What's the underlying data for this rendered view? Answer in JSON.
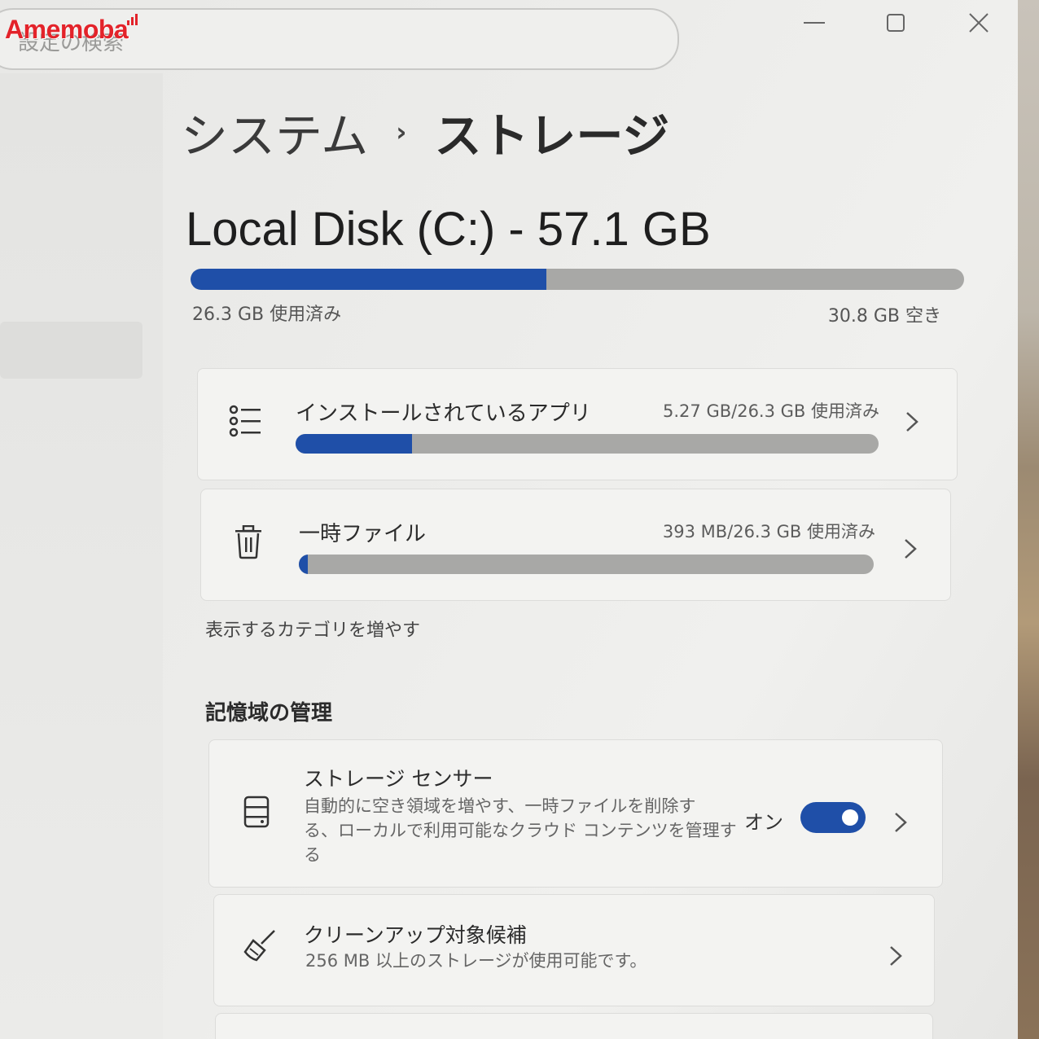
{
  "watermark": {
    "text": "Amemoba"
  },
  "search": {
    "placeholder": "設定の検索"
  },
  "window_controls": {
    "minimize": "—",
    "maximize": "☐",
    "close": "✕"
  },
  "breadcrumb": {
    "parent": "システム",
    "separator": "›",
    "current": "ストレージ"
  },
  "disk": {
    "title": "Local Disk (C:) - 57.1 GB",
    "used_label": "26.3 GB 使用済み",
    "free_label": "30.8 GB 空き",
    "used_fraction": 0.46
  },
  "categories": [
    {
      "title": "インストールされているアプリ",
      "value": "5.27 GB/26.3 GB 使用済み",
      "fraction": 0.2,
      "icon": "apps-list-icon"
    },
    {
      "title": "一時ファイル",
      "value": "393 MB/26.3 GB 使用済み",
      "fraction": 0.015,
      "icon": "trash-icon"
    }
  ],
  "more_categories": "表示するカテゴリを増やす",
  "storage_management": {
    "heading": "記憶域の管理",
    "storage_sense": {
      "title": "ストレージ センサー",
      "desc_line1": "自動的に空き領域を増やす、一時ファイルを削除す",
      "desc_line2": "る、ローカルで利用可能なクラウド コンテンツを管理す",
      "desc_line3": "る",
      "toggle_label": "オン",
      "toggle_on": true,
      "icon": "storage-drive-icon"
    },
    "cleanup": {
      "title": "クリーンアップ対象候補",
      "desc": "256 MB 以上のストレージが使用可能です。",
      "icon": "broom-icon"
    }
  },
  "colors": {
    "accent": "#1f4fa8",
    "bar_track": "#a8a8a6"
  }
}
